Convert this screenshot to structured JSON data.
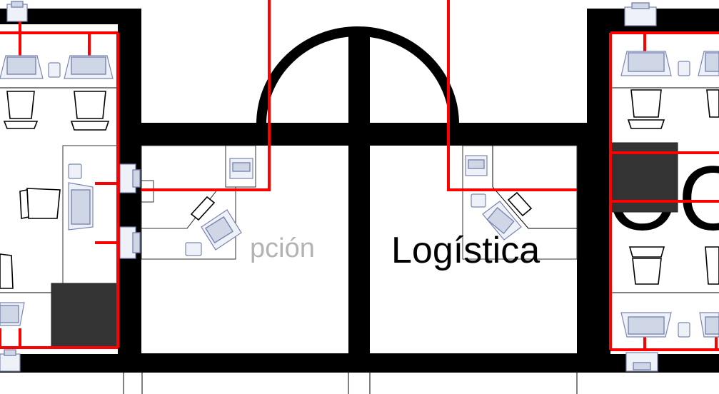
{
  "rooms": [
    {
      "id": "left",
      "label": "",
      "color": ""
    },
    {
      "id": "center-left",
      "label": "pción",
      "color": "#b3b3b3"
    },
    {
      "id": "center-right",
      "label": "Logística",
      "color": "#000000"
    },
    {
      "id": "right",
      "label": "",
      "color": ""
    }
  ],
  "right_big_text": "OC",
  "colors": {
    "wall": "#000000",
    "cable": "#ff0000",
    "device": "#7a86b0",
    "cabinet": "#333333"
  },
  "icons": [
    "printer-icon",
    "laptop-icon",
    "phone-icon",
    "chair-icon",
    "monitor-icon",
    "cabinet-icon"
  ]
}
